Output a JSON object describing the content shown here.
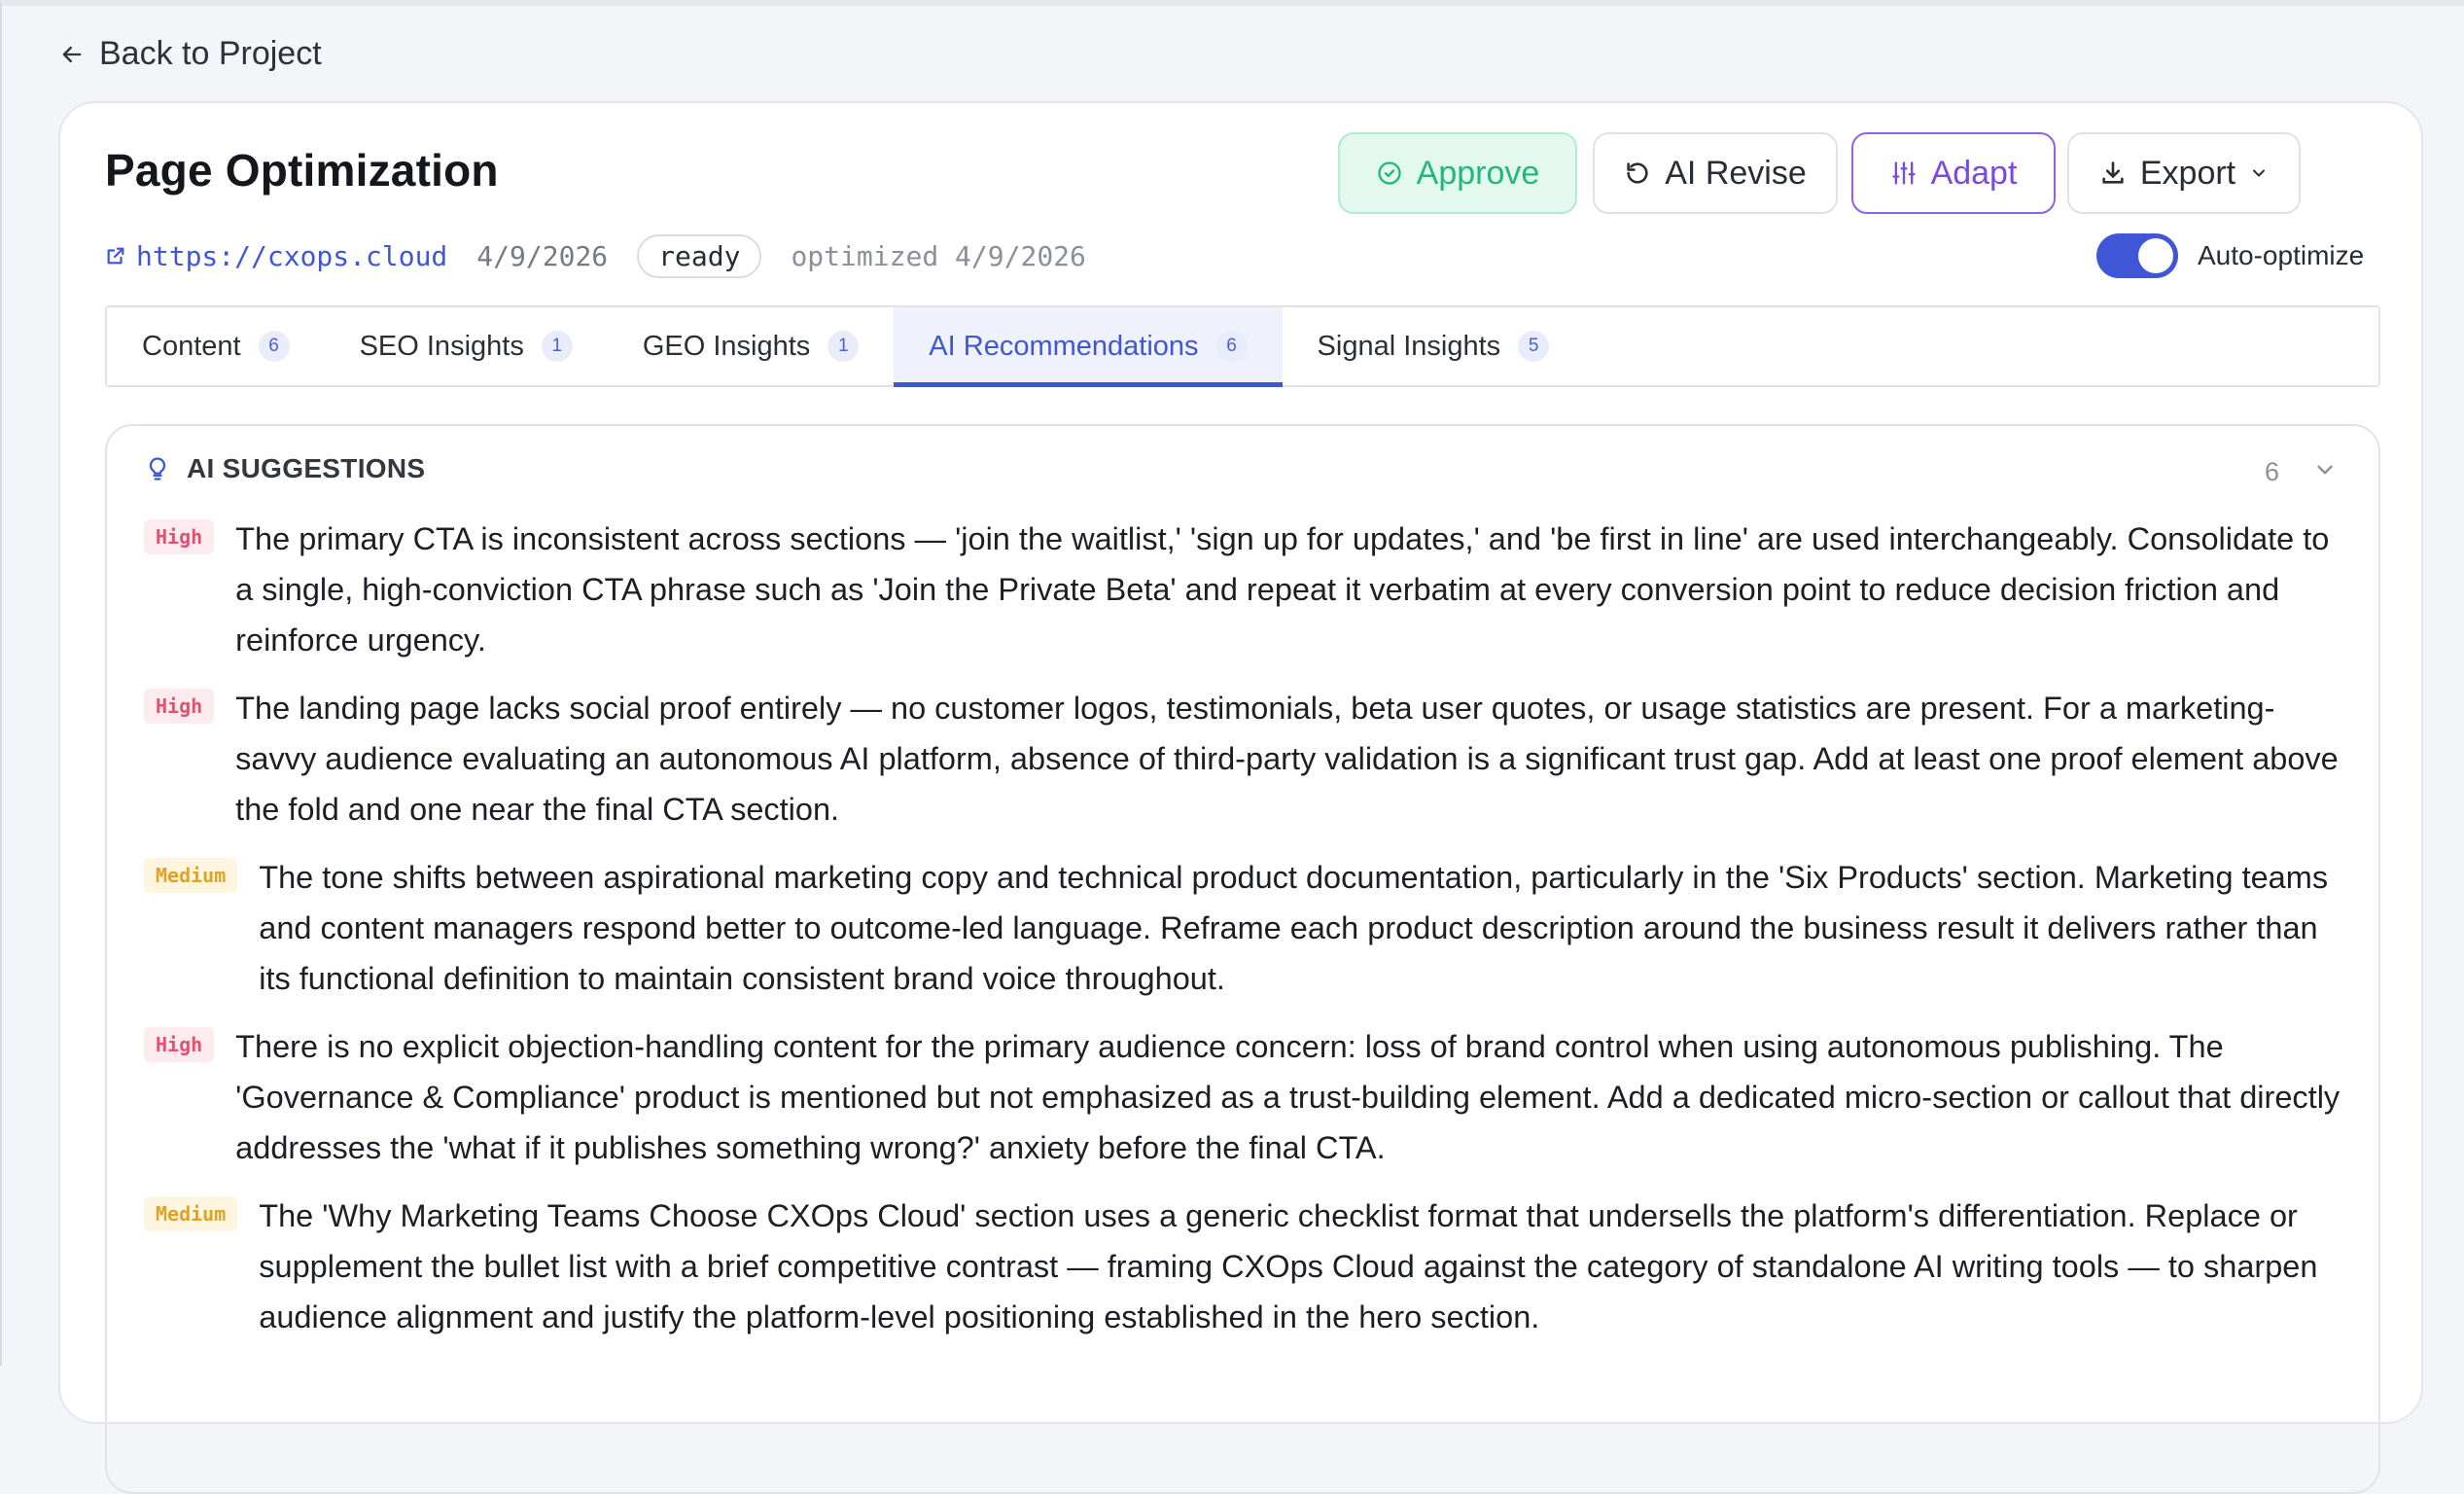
{
  "nav": {
    "back_label": "Back to Project"
  },
  "header": {
    "title": "Page Optimization",
    "url": "https://cxops.cloud",
    "date": "4/9/2026",
    "status": "ready",
    "optimized": "optimized 4/9/2026",
    "auto_optimize_label": "Auto-optimize",
    "auto_optimize_on": true
  },
  "actions": {
    "approve": "Approve",
    "revise": "AI Revise",
    "adapt": "Adapt",
    "export": "Export"
  },
  "tabs": [
    {
      "label": "Content",
      "count": "6"
    },
    {
      "label": "SEO Insights",
      "count": "1"
    },
    {
      "label": "GEO Insights",
      "count": "1"
    },
    {
      "label": "AI Recommendations",
      "count": "6",
      "active": true
    },
    {
      "label": "Signal Insights",
      "count": "5"
    }
  ],
  "suggestions": {
    "title": "AI SUGGESTIONS",
    "count": "6",
    "items": [
      {
        "priority": "High",
        "text": "The primary CTA is inconsistent across sections — 'join the waitlist,' 'sign up for updates,' and 'be first in line' are used interchangeably. Consolidate to a single, high-conviction CTA phrase such as 'Join the Private Beta' and repeat it verbatim at every conversion point to reduce decision friction and reinforce urgency."
      },
      {
        "priority": "High",
        "text": "The landing page lacks social proof entirely — no customer logos, testimonials, beta user quotes, or usage statistics are present. For a marketing-savvy audience evaluating an autonomous AI platform, absence of third-party validation is a significant trust gap. Add at least one proof element above the fold and one near the final CTA section."
      },
      {
        "priority": "Medium",
        "text": "The tone shifts between aspirational marketing copy and technical product documentation, particularly in the 'Six Products' section. Marketing teams and content managers respond better to outcome-led language. Reframe each product description around the business result it delivers rather than its functional definition to maintain consistent brand voice throughout."
      },
      {
        "priority": "High",
        "text": "There is no explicit objection-handling content for the primary audience concern: loss of brand control when using autonomous publishing. The 'Governance & Compliance' product is mentioned but not emphasized as a trust-building element. Add a dedicated micro-section or callout that directly addresses the 'what if it publishes something wrong?' anxiety before the final CTA."
      },
      {
        "priority": "Medium",
        "text": "The 'Why Marketing Teams Choose CXOps Cloud' section uses a generic checklist format that undersells the platform's differentiation. Replace or supplement the bullet list with a brief competitive contrast — framing CXOps Cloud against the category of standalone AI writing tools — to sharpen audience alignment and justify the platform-level positioning established in the hero section."
      }
    ]
  },
  "colors": {
    "accent": "#3f57d6",
    "approve": "#22b87a",
    "adapt": "#7b4be0",
    "high": "#e25270",
    "medium": "#dfa425"
  }
}
